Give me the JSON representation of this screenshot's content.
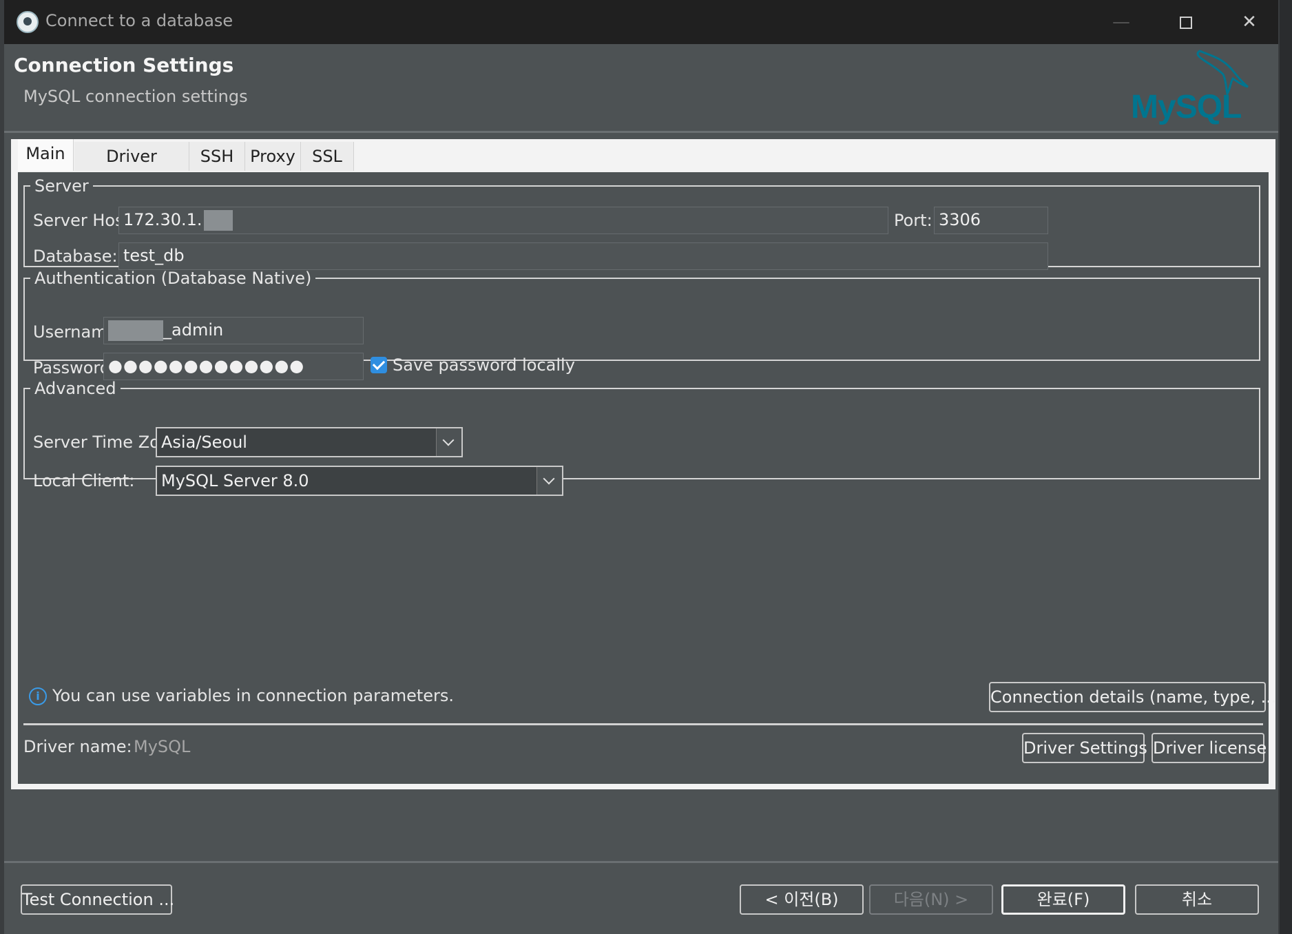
{
  "window": {
    "title": "Connect to a database",
    "minimize": "—",
    "close": "✕"
  },
  "header": {
    "title": "Connection Settings",
    "subtitle": "MySQL connection settings",
    "logo_text_my": "My",
    "logo_text_sql": "SQL"
  },
  "tabs": [
    {
      "label": "Main",
      "active": true
    },
    {
      "label": "Driver properties",
      "active": false
    },
    {
      "label": "SSH",
      "active": false
    },
    {
      "label": "Proxy",
      "active": false
    },
    {
      "label": "SSL",
      "active": false
    }
  ],
  "server": {
    "legend": "Server",
    "host_label": "Server Host:",
    "host_value": "172.30.1.",
    "port_label": "Port:",
    "port_value": "3306",
    "database_label": "Database:",
    "database_value": "test_db"
  },
  "auth": {
    "legend": "Authentication (Database Native)",
    "username_label": "Username:",
    "username_value": "_admin",
    "password_label": "Password:",
    "password_value": "●●●●●●●●●●●●●",
    "save_password_label": "Save password locally",
    "save_password_checked": true
  },
  "advanced": {
    "legend": "Advanced",
    "timezone_label": "Server Time Zone:",
    "timezone_value": "Asia/Seoul",
    "client_label": "Local Client:",
    "client_value": "MySQL Server 8.0"
  },
  "info": {
    "icon": "i",
    "text": "You can use variables in connection parameters.",
    "details_button": "Connection details (name, type, ... )"
  },
  "driver": {
    "name_label": "Driver name:",
    "name_value": "MySQL",
    "settings_button": "Driver Settings",
    "license_button": "Driver license"
  },
  "footer": {
    "test_connection": "Test Connection ...",
    "back": "< 이전(B)",
    "next": "다음(N) >",
    "finish": "완료(F)",
    "cancel": "취소"
  },
  "colors": {
    "background": "#4d5254",
    "titlebar": "#202020",
    "accent": "#2f8ee0",
    "mysql_brand": "#00758f"
  }
}
